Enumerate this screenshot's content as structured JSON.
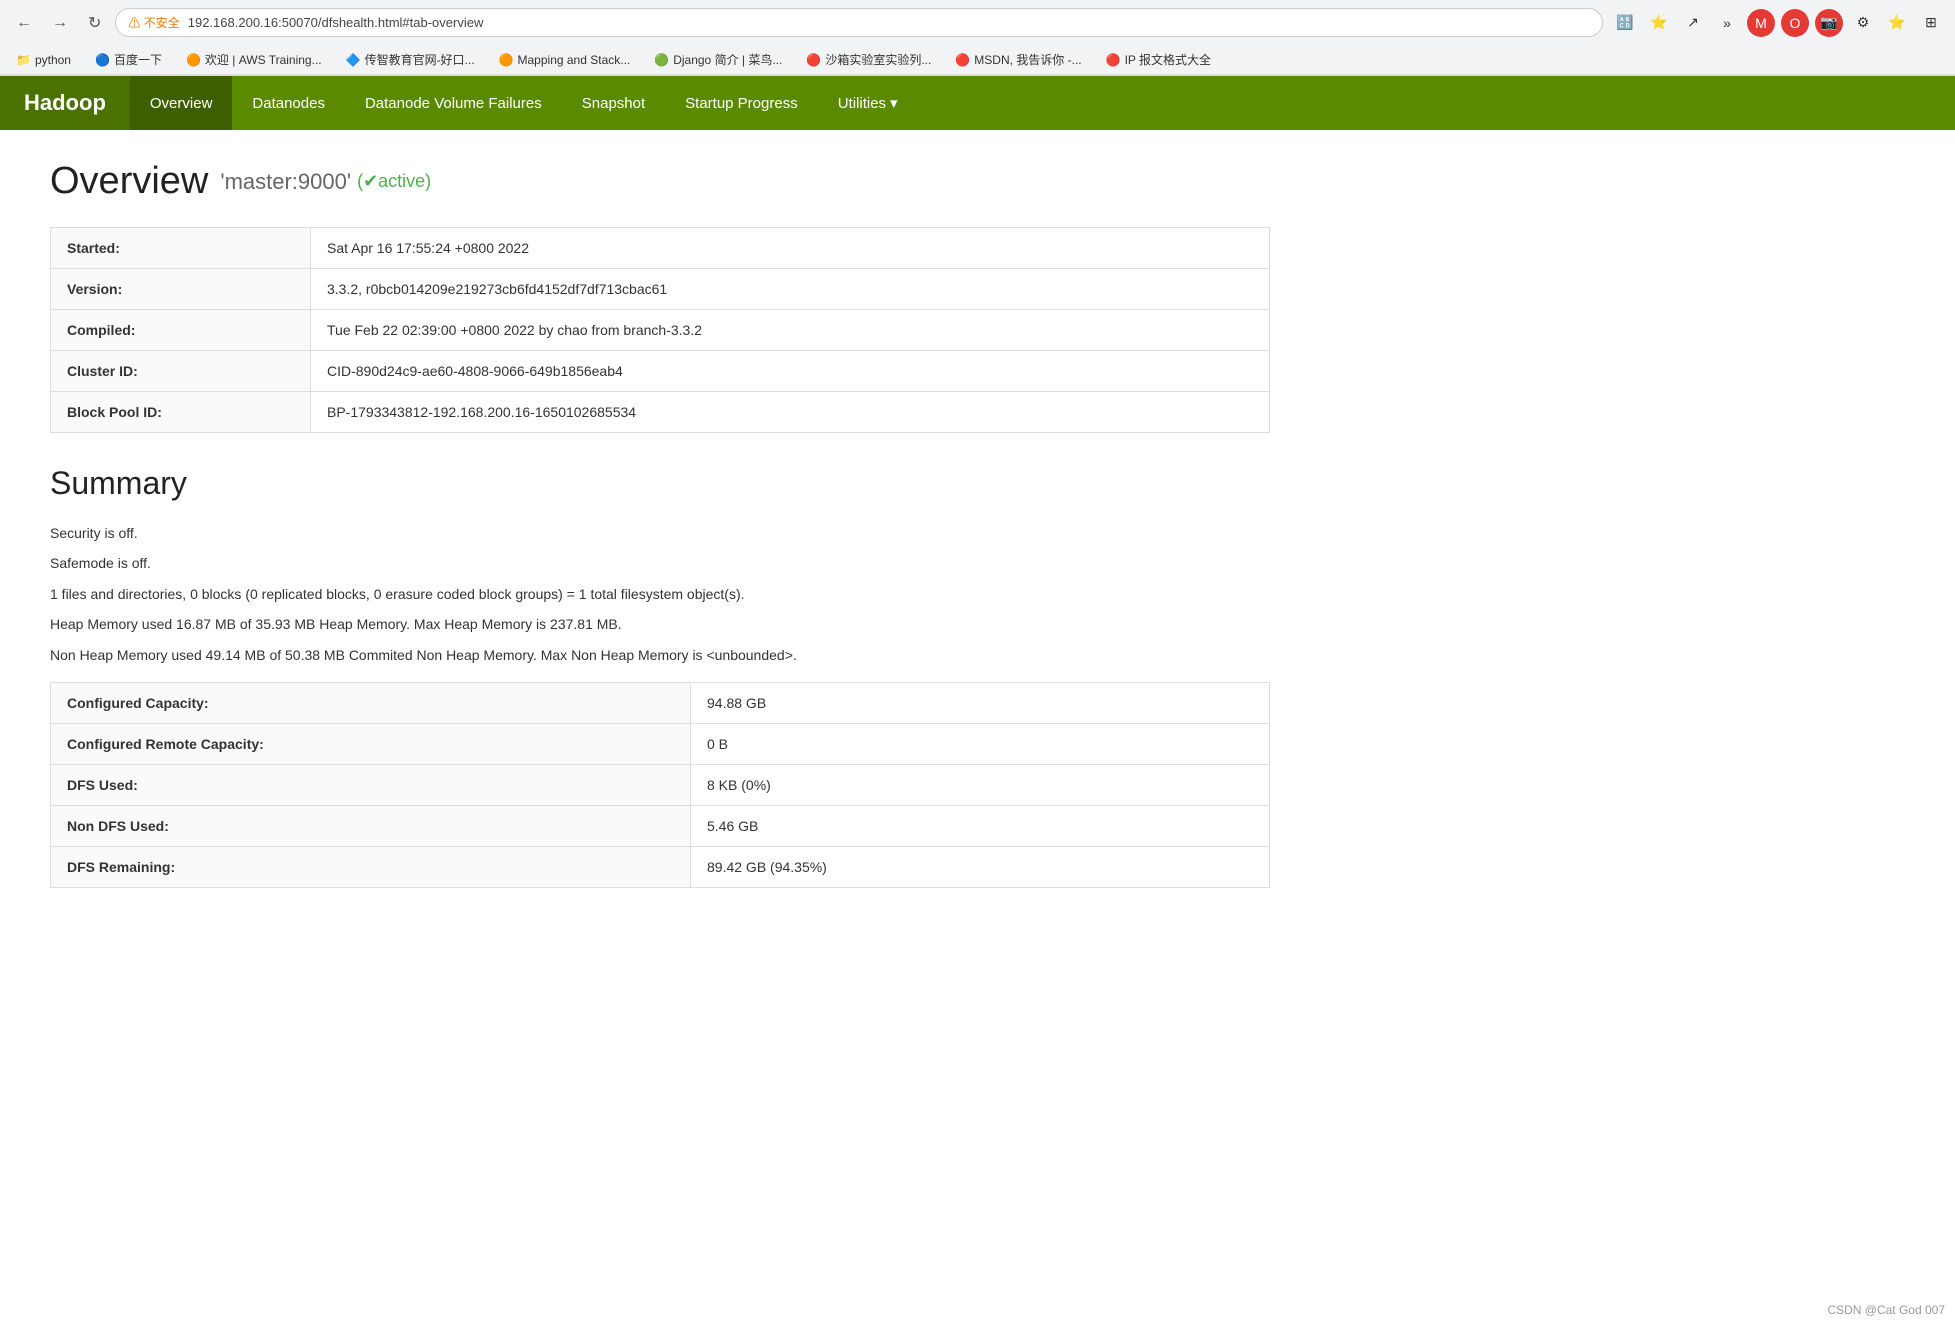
{
  "browser": {
    "back_btn": "←",
    "forward_btn": "→",
    "reload_btn": "↻",
    "warning_text": "⚠ 不安全",
    "address": "192.168.200.16:50070/dfshealth.html#tab-overview",
    "bookmarks": [
      {
        "label": "python",
        "icon": "📁"
      },
      {
        "label": "百度一下",
        "icon": "🔵"
      },
      {
        "label": "欢迎 | AWS Training...",
        "icon": "🟠"
      },
      {
        "label": "传智教育官网-好口...",
        "icon": "🔷"
      },
      {
        "label": "Mapping and Stack...",
        "icon": "🟠"
      },
      {
        "label": "Django 简介 | 菜鸟...",
        "icon": "🟢"
      },
      {
        "label": "沙箱实验室实验列...",
        "icon": "🔴"
      },
      {
        "label": "MSDN, 我告诉你 -...",
        "icon": "🔴"
      },
      {
        "label": "IP 报文格式大全",
        "icon": "🔴"
      }
    ]
  },
  "navbar": {
    "brand": "Hadoop",
    "items": [
      {
        "label": "Overview",
        "active": true
      },
      {
        "label": "Datanodes",
        "active": false
      },
      {
        "label": "Datanode Volume Failures",
        "active": false
      },
      {
        "label": "Snapshot",
        "active": false
      },
      {
        "label": "Startup Progress",
        "active": false
      },
      {
        "label": "Utilities",
        "active": false,
        "dropdown": true
      }
    ]
  },
  "overview": {
    "title": "Overview",
    "subtitle": "'master:9000'",
    "status": "(✔active)",
    "table": [
      {
        "label": "Started:",
        "value": "Sat Apr 16 17:55:24 +0800 2022"
      },
      {
        "label": "Version:",
        "value": "3.3.2, r0bcb014209e219273cb6fd4152df7df713cbac61"
      },
      {
        "label": "Compiled:",
        "value": "Tue Feb 22 02:39:00 +0800 2022 by chao from branch-3.3.2"
      },
      {
        "label": "Cluster ID:",
        "value": "CID-890d24c9-ae60-4808-9066-649b1856eab4"
      },
      {
        "label": "Block Pool ID:",
        "value": "BP-1793343812-192.168.200.16-1650102685534"
      }
    ]
  },
  "summary": {
    "title": "Summary",
    "lines": [
      "Security is off.",
      "Safemode is off.",
      "1 files and directories, 0 blocks (0 replicated blocks, 0 erasure coded block groups) = 1 total filesystem object(s).",
      "Heap Memory used 16.87 MB of 35.93 MB Heap Memory. Max Heap Memory is 237.81 MB.",
      "Non Heap Memory used 49.14 MB of 50.38 MB Commited Non Heap Memory. Max Non Heap Memory is <unbounded>."
    ],
    "table": [
      {
        "label": "Configured Capacity:",
        "value": "94.88 GB"
      },
      {
        "label": "Configured Remote Capacity:",
        "value": "0 B"
      },
      {
        "label": "DFS Used:",
        "value": "8 KB (0%)"
      },
      {
        "label": "Non DFS Used:",
        "value": "5.46 GB"
      },
      {
        "label": "DFS Remaining:",
        "value": "89.42 GB (94.35%)"
      }
    ]
  },
  "watermark": "CSDN @Cat God 007"
}
